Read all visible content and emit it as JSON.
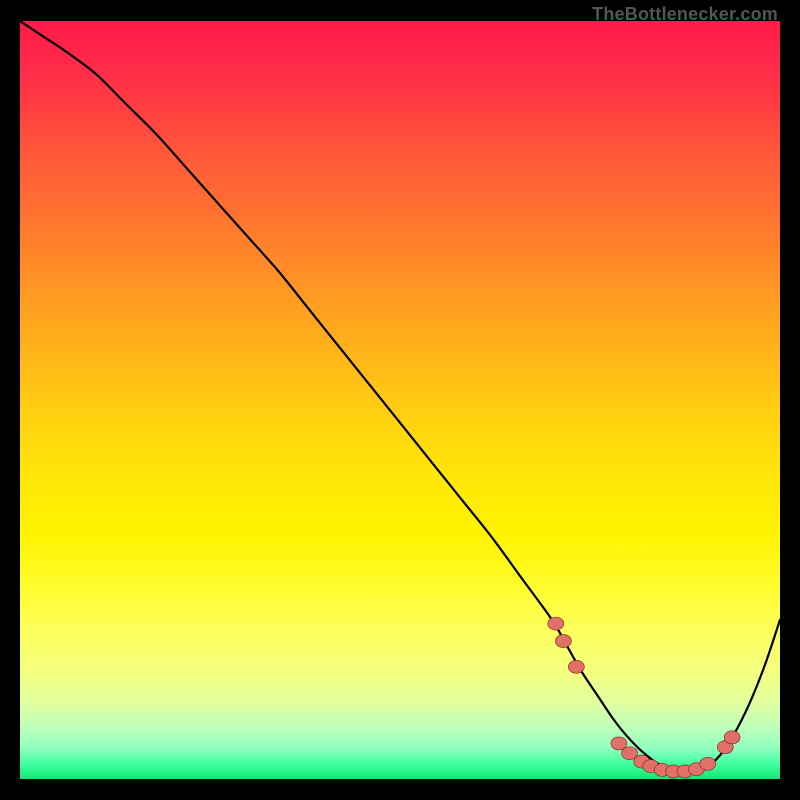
{
  "watermark": "TheBottlenecker.com",
  "colors": {
    "curve": "#000000",
    "dot_fill": "#e07068",
    "dot_stroke": "#802018",
    "border": "#000000"
  },
  "chart_data": {
    "type": "line",
    "title": "",
    "xlabel": "",
    "ylabel": "",
    "xlim": [
      0,
      100
    ],
    "ylim": [
      0,
      100
    ],
    "series": [
      {
        "name": "bottleneck-curve",
        "x": [
          0,
          3,
          6,
          10,
          14,
          18,
          22,
          26,
          30,
          34,
          38,
          42,
          46,
          50,
          54,
          58,
          62,
          66,
          70,
          72,
          74,
          76,
          78,
          80,
          82,
          84,
          86,
          88,
          90,
          92,
          94,
          96,
          98,
          100
        ],
        "y": [
          100,
          98,
          96,
          93,
          89,
          85,
          80.5,
          76,
          71.5,
          67,
          62,
          57,
          52,
          47,
          42,
          37,
          32,
          26.5,
          21,
          17.5,
          14,
          11,
          8,
          5.5,
          3.5,
          2,
          1.2,
          1,
          1.4,
          3,
          6,
          10,
          15,
          21
        ]
      }
    ],
    "markers": {
      "name": "highlight-dots",
      "points": [
        {
          "x": 70.5,
          "y": 20.5
        },
        {
          "x": 71.5,
          "y": 18.2
        },
        {
          "x": 73.2,
          "y": 14.8
        },
        {
          "x": 78.8,
          "y": 4.7
        },
        {
          "x": 80.2,
          "y": 3.4
        },
        {
          "x": 81.8,
          "y": 2.3
        },
        {
          "x": 83.0,
          "y": 1.7
        },
        {
          "x": 84.5,
          "y": 1.2
        },
        {
          "x": 86.0,
          "y": 1.0
        },
        {
          "x": 87.5,
          "y": 1.0
        },
        {
          "x": 89.0,
          "y": 1.3
        },
        {
          "x": 90.5,
          "y": 2.0
        },
        {
          "x": 92.8,
          "y": 4.2
        },
        {
          "x": 93.7,
          "y": 5.5
        }
      ]
    }
  }
}
